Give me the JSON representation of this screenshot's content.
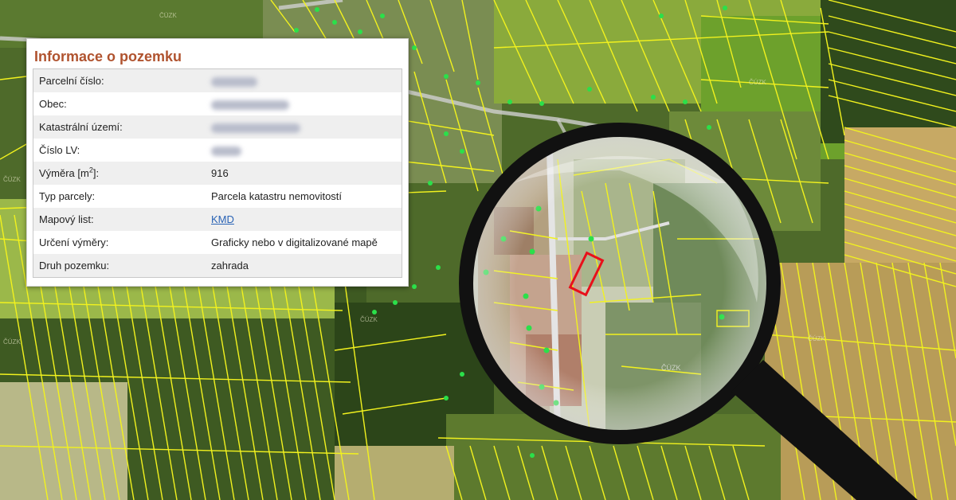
{
  "panel": {
    "title": "Informace o pozemku",
    "rows": {
      "parcel_number": {
        "label": "Parcelní číslo:"
      },
      "municipality": {
        "label": "Obec:"
      },
      "cadastral_area": {
        "label": "Katastrální území:"
      },
      "lv_number": {
        "label": "Číslo LV:"
      },
      "area": {
        "label_prefix": "Výměra [m",
        "label_sup": "2",
        "label_suffix": "]:",
        "value": "916"
      },
      "parcel_type": {
        "label": "Typ parcely:",
        "value": "Parcela katastru nemovitostí"
      },
      "map_sheet": {
        "label": "Mapový list:",
        "value": "KMD"
      },
      "area_determination": {
        "label": "Určení výměry:",
        "value": "Graficky nebo v digitalizované mapě"
      },
      "land_type": {
        "label": "Druh pozemku:",
        "value": "zahrada"
      }
    }
  },
  "map": {
    "watermark": "ČÚZK",
    "colors": {
      "parcel_line": "#f2f21e",
      "highlight": "#e8101a",
      "point": "#2be04a",
      "forest": "#2e4a1c",
      "meadow": "#7aa23a"
    }
  },
  "icons": {
    "magnifier": "magnifier-icon"
  }
}
